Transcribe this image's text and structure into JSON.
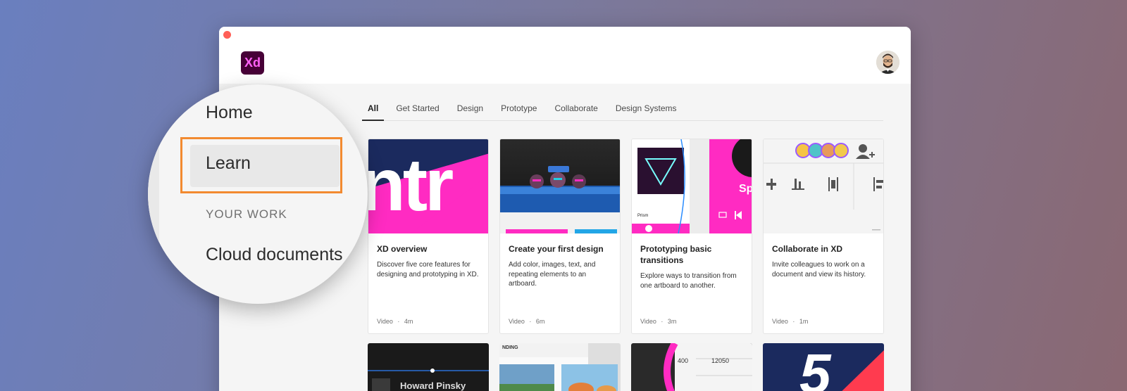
{
  "app": {
    "logo_text": "Xd",
    "logo_bg": "#470137",
    "logo_fg": "#ff61f6"
  },
  "tabs": [
    {
      "label": "All",
      "active": true
    },
    {
      "label": "Get Started",
      "active": false
    },
    {
      "label": "Design",
      "active": false
    },
    {
      "label": "Prototype",
      "active": false
    },
    {
      "label": "Collaborate",
      "active": false
    },
    {
      "label": "Design Systems",
      "active": false
    }
  ],
  "sidebar": {
    "items": [
      {
        "label": "Home"
      },
      {
        "label": "Learn",
        "selected": true
      }
    ],
    "section_label": "YOUR WORK",
    "section_items": [
      {
        "label": "Cloud documents"
      }
    ]
  },
  "cards": [
    {
      "title": "XD overview",
      "desc": "Discover five core features for designing and prototyping in XD.",
      "type": "Video",
      "duration": "4m",
      "thumb_text": "ntr"
    },
    {
      "title": "Create your first design",
      "desc": "Add color, images, text, and repeating elements to an artboard.",
      "type": "Video",
      "duration": "6m"
    },
    {
      "title": "Prototyping basic transitions",
      "desc": "Explore ways to transition from one artboard to another.",
      "type": "Video",
      "duration": "3m",
      "thumb_text": "Sp",
      "thumb_sub": "Prism"
    },
    {
      "title": "Collaborate in XD",
      "desc": "Invite colleagues to work on a document and view its history.",
      "type": "Video",
      "duration": "1m"
    }
  ],
  "row2": {
    "name_text": "Howard Pinsky",
    "ruler_label": "NDING",
    "coords": [
      "400",
      "12050"
    ],
    "number": "5"
  },
  "meta_separator": "·",
  "colors": {
    "accent_pink": "#ff2bc2",
    "highlight_orange": "#f28a30",
    "navy": "#1b2a5e"
  }
}
